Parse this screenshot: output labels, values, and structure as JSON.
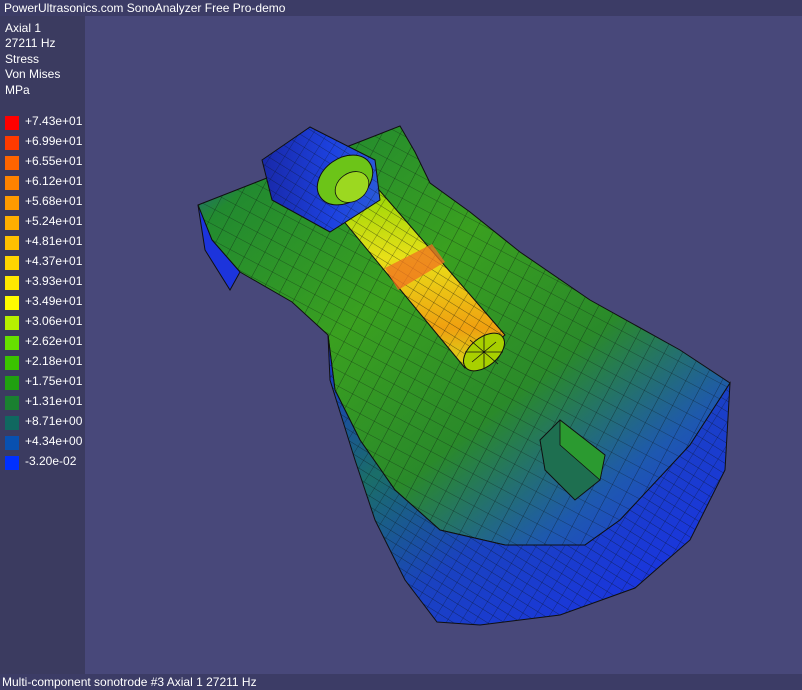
{
  "window": {
    "title": "PowerUltrasonics.com SonoAnalyzer Free Pro-demo"
  },
  "info": {
    "mode": "Axial 1",
    "frequency": "27211 Hz",
    "quantity": "Stress",
    "criterion": "Von Mises",
    "unit": "MPa"
  },
  "legend": {
    "items": [
      {
        "label": "+7.43e+01",
        "color": "#ff0000"
      },
      {
        "label": "+6.99e+01",
        "color": "#ff3a00"
      },
      {
        "label": "+6.55e+01",
        "color": "#ff6400"
      },
      {
        "label": "+6.12e+01",
        "color": "#ff8200"
      },
      {
        "label": "+5.68e+01",
        "color": "#ff9a00"
      },
      {
        "label": "+5.24e+01",
        "color": "#ffae00"
      },
      {
        "label": "+4.81e+01",
        "color": "#ffc000"
      },
      {
        "label": "+4.37e+01",
        "color": "#ffd400"
      },
      {
        "label": "+3.93e+01",
        "color": "#ffe800"
      },
      {
        "label": "+3.49e+01",
        "color": "#fffc00"
      },
      {
        "label": "+3.06e+01",
        "color": "#b6f000"
      },
      {
        "label": "+2.62e+01",
        "color": "#66e000"
      },
      {
        "label": "+2.18e+01",
        "color": "#3ac400"
      },
      {
        "label": "+1.75e+01",
        "color": "#20a010"
      },
      {
        "label": "+1.31e+01",
        "color": "#1a8030"
      },
      {
        "label": "+8.71e+00",
        "color": "#106860"
      },
      {
        "label": "+4.34e+00",
        "color": "#0850b0"
      },
      {
        "label": "-3.20e-02",
        "color": "#0030ff"
      }
    ]
  },
  "status": {
    "text": "Multi-component sonotrode #3 Axial 1 27211 Hz"
  }
}
